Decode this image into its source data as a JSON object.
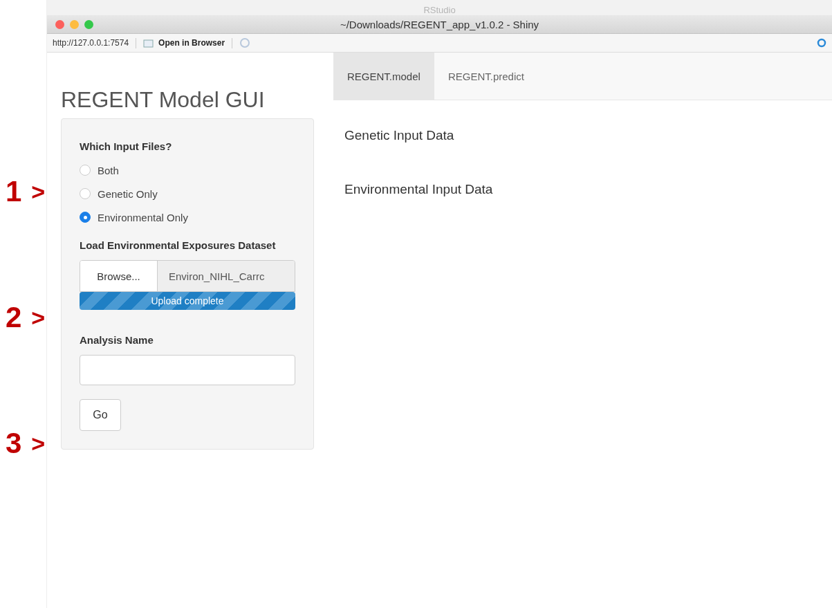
{
  "annotations": [
    {
      "number": "1",
      "mark": ">"
    },
    {
      "number": "2",
      "mark": ">"
    },
    {
      "number": "3",
      "mark": ">"
    }
  ],
  "window": {
    "app": "RStudio",
    "title": "~/Downloads/REGENT_app_v1.0.2 - Shiny"
  },
  "toolbar": {
    "url": "http://127.0.0.1:7574",
    "open_button": "Open in Browser"
  },
  "app_title": "REGENT Model GUI",
  "tabs": [
    {
      "label": "REGENT.model",
      "selected": true
    },
    {
      "label": "REGENT.predict",
      "selected": false
    }
  ],
  "sidebar": {
    "radio_label": "Which Input Files?",
    "options": [
      {
        "label": "Both",
        "selected": false
      },
      {
        "label": "Genetic Only",
        "selected": false
      },
      {
        "label": "Environmental Only",
        "selected": true
      }
    ],
    "file_label": "Load Environmental Exposures Dataset",
    "browse_button": "Browse...",
    "file_name": "Environ_NIHL_Carrc",
    "progress": {
      "level": 1,
      "text": "Upload complete"
    },
    "name_label": "Analysis Name",
    "go_button": "Go"
  },
  "main": {
    "headings": [
      "Genetic Input Data",
      "Environmental Input Data"
    ]
  }
}
